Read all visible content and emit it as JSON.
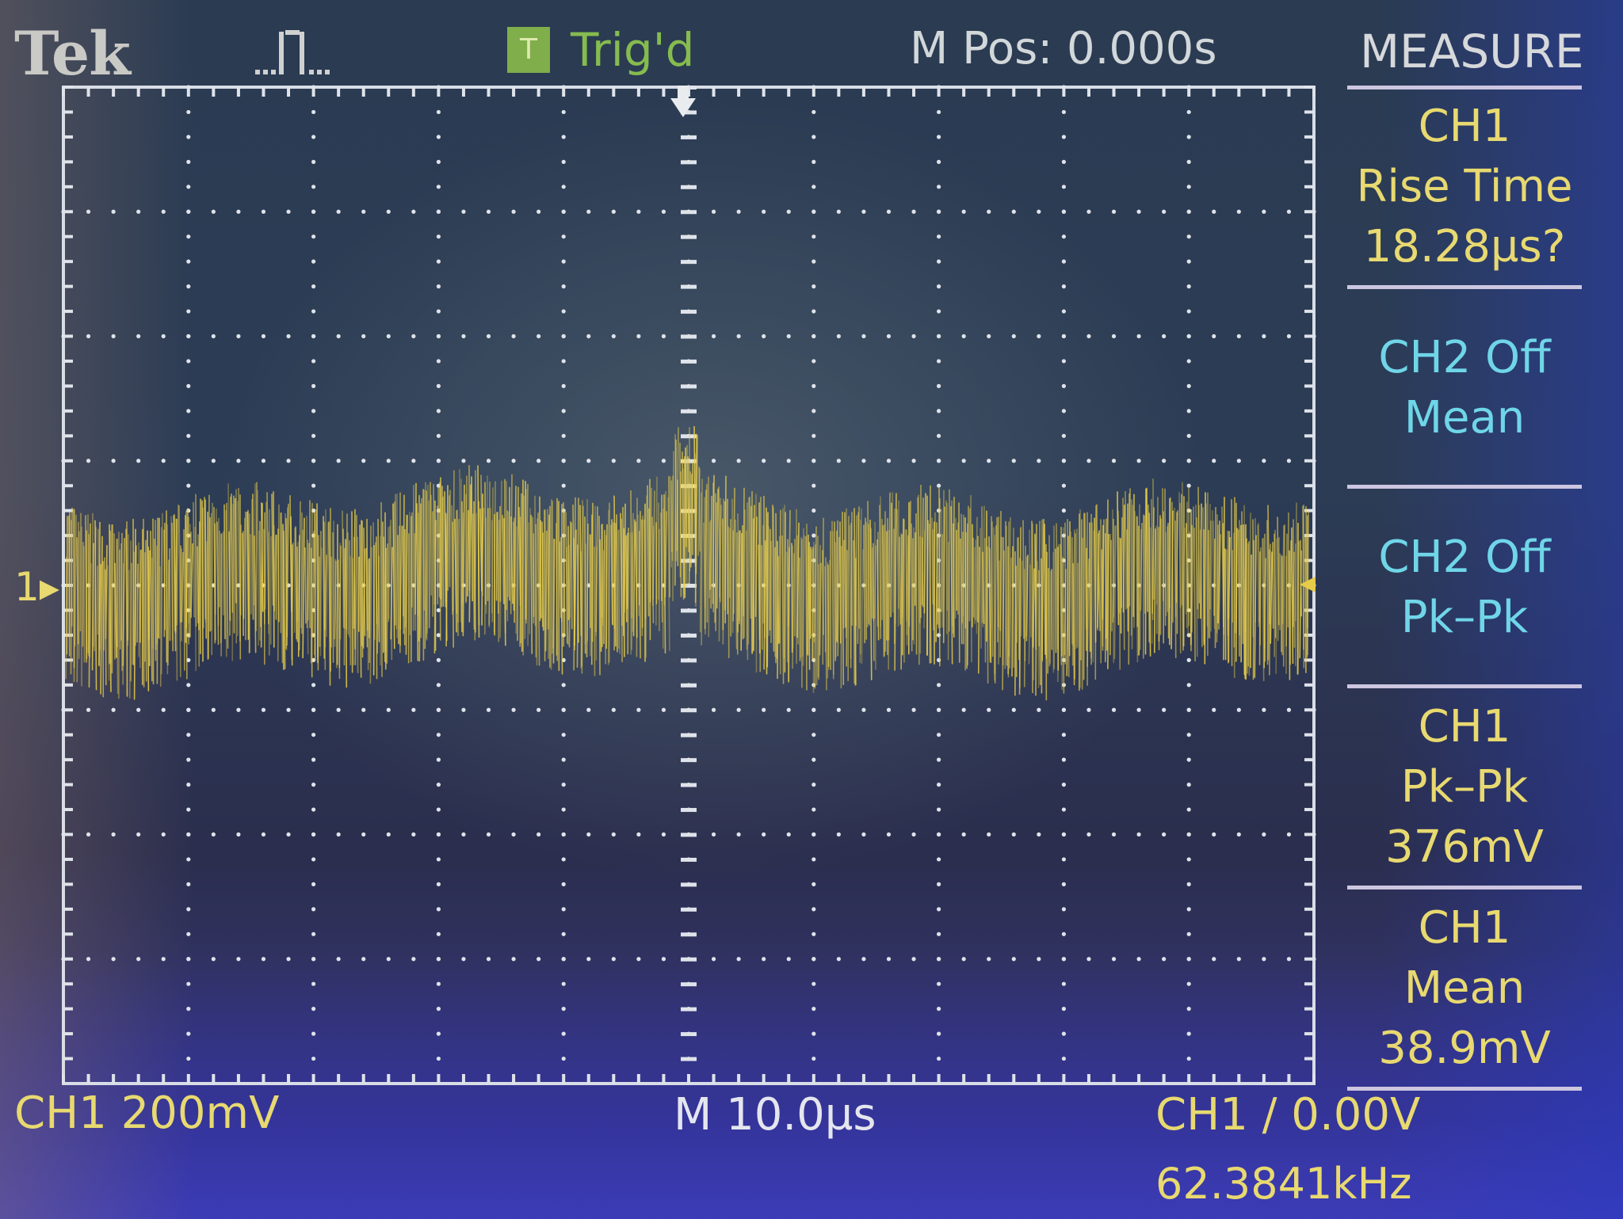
{
  "header": {
    "brand": "Tek",
    "acquisition_icon": "pulse-run-icon",
    "trigger_badge": "T",
    "trigger_status": "Trig'd",
    "horizontal_position": "M Pos: 0.000s",
    "menu_title": "MEASURE"
  },
  "measurements": [
    {
      "lines": [
        "CH1",
        "Rise Time",
        "18.28µs?"
      ],
      "color": "#e8d970"
    },
    {
      "lines": [
        "CH2 Off",
        "Mean"
      ],
      "color": "#6fd6e8"
    },
    {
      "lines": [
        "CH2 Off",
        "Pk–Pk"
      ],
      "color": "#6fd6e8"
    },
    {
      "lines": [
        "CH1",
        "Pk–Pk",
        "376mV"
      ],
      "color": "#e8d970"
    },
    {
      "lines": [
        "CH1",
        "Mean",
        "38.9mV"
      ],
      "color": "#e8d970"
    }
  ],
  "status_bar": {
    "ch1_scale": "CH1  200mV",
    "timebase": "M 10.0µs",
    "trigger": "CH1 ∕ 0.00V",
    "frequency": "62.3841kHz"
  },
  "channel_marker": "1",
  "colors": {
    "trace": "#e6cc4a",
    "ch2_text": "#6fd6e8",
    "ch1_text": "#e8d970",
    "grid": "#d8dde6",
    "trigger_green": "#86bb4f"
  }
}
